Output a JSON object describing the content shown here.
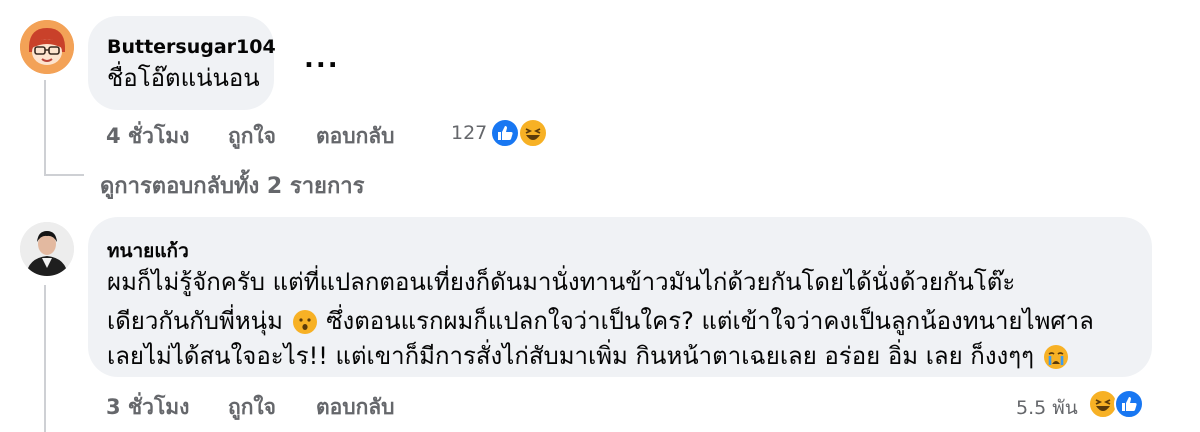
{
  "comments": [
    {
      "author": "Buttersugar104",
      "text": "ชื่อโอ๊ตแน่นอน",
      "more_label": "...",
      "time": "4 ชั่วโมง",
      "like_label": "ถูกใจ",
      "reply_label": "ตอบกลับ",
      "reaction_count": "127",
      "reaction_icons": [
        "like-icon",
        "haha-icon"
      ],
      "view_replies_label": "ดูการตอบกลับทั้ง 2 รายการ"
    },
    {
      "author": "ทนายแก้ว",
      "text_lines": [
        "ผมก็ไม่รู้จักครับ แต่ที่แปลกตอนเที่ยงก็ดันมานั่งทานข้าวมันไก่ด้วยกันโดยได้นั่งด้วยกันโต๊ะ",
        "เดียวกันกับพี่หนุ่ม",
        "ซึ่งตอนแรกผมก็แปลกใจว่าเป็นใคร? แต่เข้าใจว่าคงเป็นลูกน้องทนายไพศาล",
        "เลยไม่ได้สนใจอะไร!! แต่เขาก็มีการสั่งไก่สับมาเพิ่ม กินหน้าตาเฉยเลย อร่อย อิ่ม เลย ก็งงๆๆ"
      ],
      "inline_emojis": [
        "hushed-face-icon",
        "crying-face-icon"
      ],
      "time": "3 ชั่วโมง",
      "like_label": "ถูกใจ",
      "reply_label": "ตอบกลับ",
      "reaction_count": "5.5 พัน",
      "reaction_icons": [
        "haha-icon",
        "like-icon"
      ]
    }
  ],
  "colors": {
    "bubble": "#f0f2f5",
    "secondary_text": "#65676b",
    "like_blue": "#1877f2",
    "haha_yellow": "#f7b125",
    "thread_line": "#ced0d4"
  }
}
